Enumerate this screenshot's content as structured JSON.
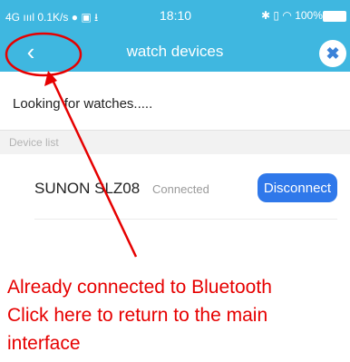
{
  "status_bar": {
    "network": "4G",
    "speed": "0.1K/s",
    "time": "18:10",
    "battery": "100%"
  },
  "nav": {
    "back_icon": "‹",
    "title": "watch devices"
  },
  "scan": {
    "text": "Looking for watches....."
  },
  "device_list": {
    "header": "Device list",
    "devices": [
      {
        "name": "SUNON SLZ08",
        "status": "Connected",
        "action_label": "Disconnect"
      }
    ]
  },
  "annotation": {
    "lines": [
      "Already connected to Bluetooth",
      "Click here to return to the main",
      "interface"
    ],
    "color": "#e60000"
  },
  "colors": {
    "accent": "#3fb7e0",
    "button": "#2f78ea"
  }
}
